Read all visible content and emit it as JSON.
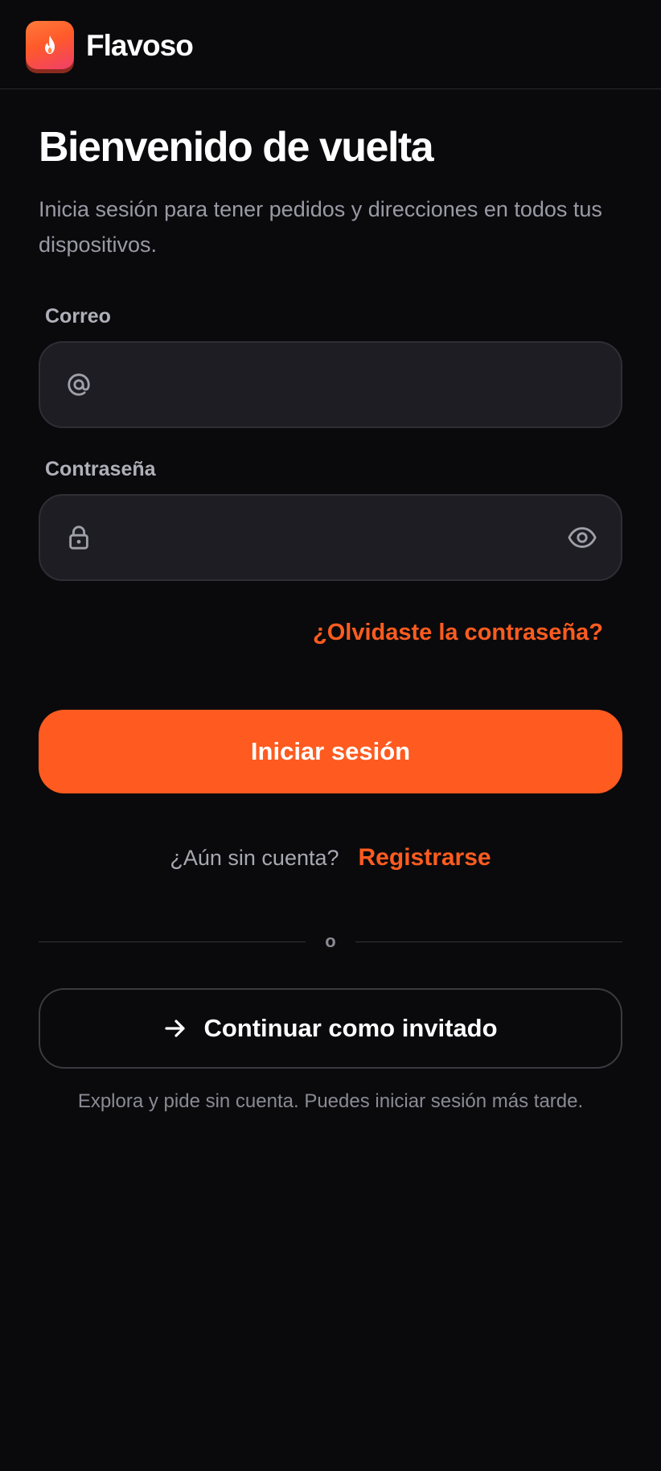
{
  "header": {
    "brand": "Flavoso",
    "logo_icon": "flame-icon"
  },
  "login": {
    "title": "Bienvenido de vuelta",
    "subtitle": "Inicia sesión para tener pedidos y direcciones en todos tus dispositivos.",
    "email": {
      "label": "Correo",
      "value": "",
      "placeholder": "",
      "icon": "at-sign-icon"
    },
    "password": {
      "label": "Contraseña",
      "value": "",
      "placeholder": "",
      "icon": "lock-icon",
      "toggle_icon": "eye-icon"
    },
    "forgot_label": "¿Olvidaste la contraseña?",
    "submit_label": "Iniciar sesión",
    "signup_prompt": "¿Aún sin cuenta?",
    "signup_label": "Registrarse",
    "divider_text": "o",
    "guest_label": "Continuar como invitado",
    "guest_icon": "arrow-right-icon",
    "guest_note": "Explora y pide sin cuenta. Puedes iniciar sesión más tarde."
  },
  "colors": {
    "background": "#0a0a0c",
    "accent": "#ff5a1f",
    "field_background": "#1d1d23",
    "muted_text": "#9a9aa6"
  }
}
